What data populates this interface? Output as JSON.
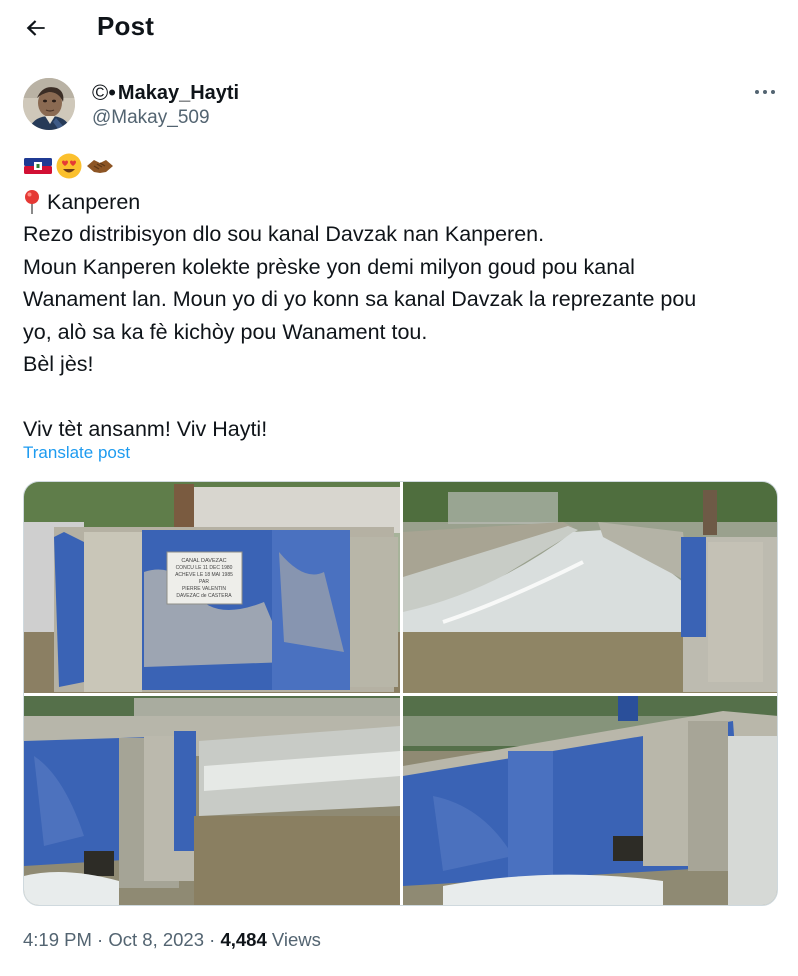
{
  "header": {
    "title": "Post",
    "back_icon": "arrow-left-icon"
  },
  "author": {
    "display_name": "Makay_Hayti",
    "name_prefix": "©•",
    "handle": "@Makay_509"
  },
  "more_icon": "more-horizontal-icon",
  "post": {
    "emojis": [
      "haiti-flag-emoji",
      "heart-eyes-emoji",
      "handshake-emoji"
    ],
    "location_icon": "round-pushpin-icon",
    "location": "Kanperen",
    "lines": [
      "Rezo distribisyon dlo sou kanal Davzak nan Kanperen.",
      "Moun Kanperen kolekte prèske yon demi milyon goud pou kanal",
      "Wanament lan. Moun yo di yo konn sa kanal Davzak la reprezante pou",
      "yo, alò sa ka fè kichòy pou Wanament tou.",
      "Bèl jès!",
      "",
      "Viv tèt ansanm! Viv Hayti!"
    ],
    "translate_label": "Translate post"
  },
  "media": {
    "plaque_lines": [
      "CANAL DAVEZAC",
      "CONCU LE 11 DEC 1980",
      "ACHEVE LE 18 MAI 1985",
      "PAR",
      "PIERRE VALENTIN",
      "DAVEZAC de CASTERA"
    ]
  },
  "meta": {
    "time": "4:19 PM",
    "separator": "·",
    "date": "Oct 8, 2023",
    "views_count": "4,484",
    "views_label": "Views"
  },
  "colors": {
    "text": "#0f1419",
    "secondary": "#536471",
    "link": "#1d9bf0",
    "border": "#cfd9de",
    "wall_blue": "#3a63b5"
  }
}
